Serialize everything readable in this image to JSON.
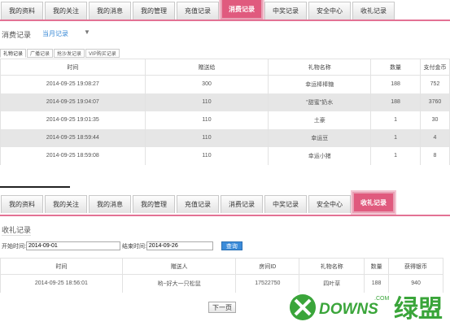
{
  "tabs_top": [
    {
      "label": "我的资料",
      "active": false
    },
    {
      "label": "我的关注",
      "active": false
    },
    {
      "label": "我的消息",
      "active": false
    },
    {
      "label": "我的管理",
      "active": false
    },
    {
      "label": "充值记录",
      "active": false
    },
    {
      "label": "消费记录",
      "active": true
    },
    {
      "label": "中奖记录",
      "active": false
    },
    {
      "label": "安全中心",
      "active": false
    },
    {
      "label": "收礼记录",
      "active": false
    }
  ],
  "consume": {
    "title": "消费记录",
    "filter": "当月记录",
    "subtabs": [
      "礼物记录",
      "广播记录",
      "抢沙发记录",
      "VIP购买记录"
    ],
    "headers": [
      "时间",
      "赠送给",
      "礼物名称",
      "数量",
      "支付金币"
    ],
    "rows": [
      [
        "2014-09-25 19:08:27",
        "300",
        "幸运棒棒糖",
        "188",
        "752"
      ],
      [
        "2014-09-25 19:04:07",
        "110",
        "\"甜蜜\"奶水",
        "188",
        "3760"
      ],
      [
        "2014-09-25 19:01:35",
        "110",
        "土豪",
        "1",
        "30"
      ],
      [
        "2014-09-25 18:59:44",
        "110",
        "幸运豆",
        "1",
        "4"
      ],
      [
        "2014-09-25 18:59:08",
        "110",
        "幸运小猪",
        "1",
        "8"
      ]
    ]
  },
  "tabs_bottom": [
    {
      "label": "我的资料",
      "active": false
    },
    {
      "label": "我的关注",
      "active": false
    },
    {
      "label": "我的消息",
      "active": false
    },
    {
      "label": "我的管理",
      "active": false
    },
    {
      "label": "充值记录",
      "active": false
    },
    {
      "label": "消费记录",
      "active": false
    },
    {
      "label": "中奖记录",
      "active": false
    },
    {
      "label": "安全中心",
      "active": false
    },
    {
      "label": "收礼记录",
      "active": true
    }
  ],
  "receive": {
    "title": "收礼记录",
    "start_label": "开始时间:",
    "start_value": "2014-09-01",
    "end_label": "结束时间:",
    "end_value": "2014-09-26",
    "query": "查询",
    "headers": [
      "时间",
      "赠送人",
      "房间ID",
      "礼物名称",
      "数量",
      "获得银币"
    ],
    "rows": [
      [
        "2014-09-25 18:56:01",
        "哟~好大一只松鼠",
        "17522750",
        "四叶草",
        "188",
        "940"
      ]
    ],
    "next_page": "下一页"
  },
  "watermark": {
    "brand": "DOWNS",
    "cn": "绿盟",
    "com": ".COM",
    "accent": "#3aa53a"
  }
}
